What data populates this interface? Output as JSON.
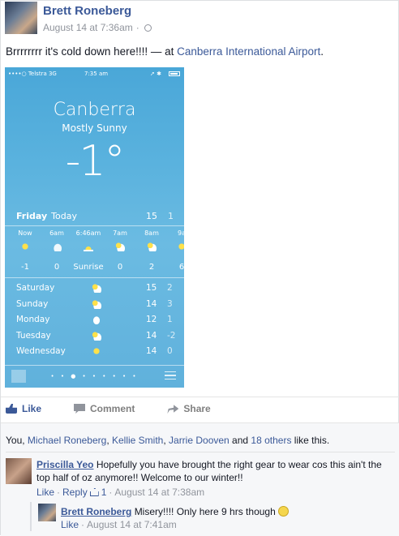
{
  "post": {
    "author": "Brett Roneberg",
    "timestamp": "August 14 at 7:36am",
    "separator": "·",
    "text_prefix": "Brrrrrrrr it's cold down here!!!! — at ",
    "location": "Canberra International Airport",
    "text_suffix": "."
  },
  "weather": {
    "status": {
      "carrier": "••••○ Telstra  3G",
      "time": "7:35 am",
      "arrow": "➚ ✱"
    },
    "city": "Canberra",
    "condition": "Mostly Sunny",
    "temp": "-1°",
    "today": {
      "day": "Friday",
      "label": "Today",
      "hi": "15",
      "lo": "1"
    },
    "hourly": [
      {
        "label": "Now",
        "icon": "sun-icon",
        "value": "-1"
      },
      {
        "label": "6am",
        "icon": "moon-cloud-icon",
        "value": "0"
      },
      {
        "label": "6:46am",
        "icon": "sunrise-icon",
        "value": "Sunrise"
      },
      {
        "label": "7am",
        "icon": "sun-cloud-icon",
        "value": "0"
      },
      {
        "label": "8am",
        "icon": "sun-cloud-icon",
        "value": "2"
      },
      {
        "label": "9a",
        "icon": "sun-icon",
        "value": "6"
      }
    ],
    "daily": [
      {
        "day": "Saturday",
        "icon": "sun-cloud-icon",
        "hi": "15",
        "lo": "2"
      },
      {
        "day": "Sunday",
        "icon": "sun-cloud-icon",
        "hi": "14",
        "lo": "3"
      },
      {
        "day": "Monday",
        "icon": "cloud-icon",
        "hi": "12",
        "lo": "1"
      },
      {
        "day": "Tuesday",
        "icon": "sun-cloud-icon",
        "hi": "14",
        "lo": "-2"
      },
      {
        "day": "Wednesday",
        "icon": "sun-icon",
        "hi": "14",
        "lo": "0"
      }
    ],
    "page_dots": "• • ● • • • • • •"
  },
  "actions": {
    "like": "Like",
    "comment": "Comment",
    "share": "Share"
  },
  "likes": {
    "prefix": "You, ",
    "names": [
      "Michael Roneberg",
      "Kellie Smith",
      "Jarrie Dooven"
    ],
    "and": " and ",
    "others": "18 others",
    "suffix": " like this."
  },
  "comments": [
    {
      "author": "Priscilla Yeo",
      "text": "Hopefully you have brought the right gear to wear cos this ain't the top half of oz anymore!! Welcome to our winter!!",
      "like": "Like",
      "reply": "Reply",
      "like_count": "1",
      "timestamp": "August 14 at 7:38am"
    },
    {
      "author": "Brett Roneberg",
      "text": "Misery!!!! Only here 9 hrs though ",
      "like": "Like",
      "timestamp": "August 14 at 7:41am"
    }
  ],
  "colors": {
    "link": "#3b5998",
    "muted": "#90949c",
    "sky": "#5ab2de"
  }
}
